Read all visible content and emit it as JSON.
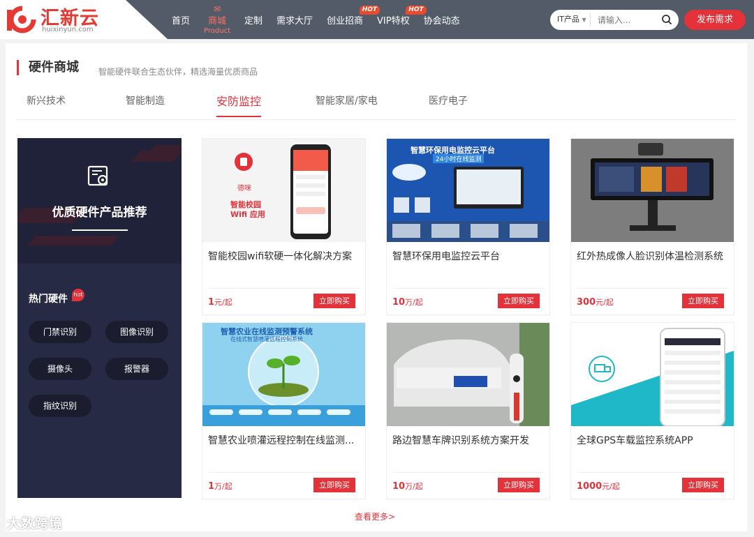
{
  "header": {
    "brand": "汇新云",
    "domain": "huixinyun.com",
    "nav": [
      {
        "label": "首页",
        "hot": ""
      },
      {
        "label": "商城",
        "sub": "Product",
        "hot": ""
      },
      {
        "label": "定制",
        "hot": ""
      },
      {
        "label": "需求大厅",
        "hot": ""
      },
      {
        "label": "创业招商",
        "hot": "HOT"
      },
      {
        "label": "VIP特权",
        "hot": "HOT"
      },
      {
        "label": "协会动态",
        "hot": ""
      }
    ],
    "search": {
      "category": "IT产品",
      "placeholder": "请输入..."
    },
    "publish_label": "发布需求"
  },
  "section": {
    "title": "硬件商城",
    "desc": "智能硬件联合生态伙伴，精选海量优质商品"
  },
  "tabs": [
    "新兴技术",
    "智能制造",
    "安防监控",
    "智能家居/家电",
    "医疗电子"
  ],
  "active_tab": "安防监控",
  "sidebar": {
    "title": "优质硬件产品推荐",
    "hot_title": "热门硬件",
    "hot_badge": "hot",
    "tags": [
      "门禁识别",
      "图像识别",
      "摄像头",
      "报警器",
      "指纹识别"
    ]
  },
  "products": [
    {
      "name": "智能校园wifi软硬一体化解决方案",
      "price": "1",
      "unit": "元/起",
      "buy": "立即购买",
      "img_text": [
        "智能校园",
        "Wifi 应用"
      ],
      "img_logo": "德咪"
    },
    {
      "name": "智慧环保用电监控云平台",
      "price": "10",
      "unit": "万/起",
      "buy": "立即购买",
      "img_text": [
        "智慧环保用电监控云平台",
        "24小时在线监测"
      ]
    },
    {
      "name": "红外热成像人脸识别体温检测系统",
      "price": "300",
      "unit": "元/起",
      "buy": "立即购买"
    },
    {
      "name": "智慧农业喷灌远程控制在线监测...",
      "price": "1",
      "unit": "万/起",
      "buy": "立即购买",
      "img_text": [
        "智慧农业在线监测预警系统",
        "在线式智慧喷灌远程控制系统"
      ]
    },
    {
      "name": "路边智慧车牌识别系统方案开发",
      "price": "10",
      "unit": "万/起",
      "buy": "立即购买"
    },
    {
      "name": "全球GPS车载监控系统APP",
      "price": "1000",
      "unit": "元/起",
      "buy": "立即购买"
    }
  ],
  "more_label": "查看更多>",
  "watermark": "大数跨境"
}
